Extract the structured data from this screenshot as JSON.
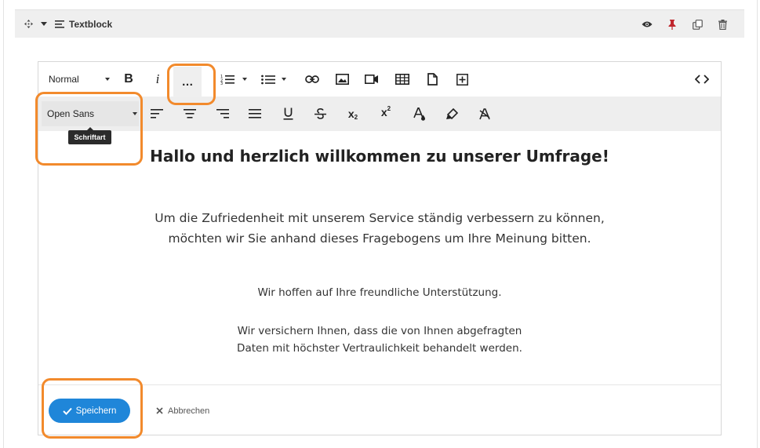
{
  "header": {
    "title": "Textblock",
    "icons": [
      "move-icon",
      "collapse-caret-icon",
      "textblock-lines-icon",
      "eye-icon",
      "pin-icon",
      "copy-icon",
      "trash-icon"
    ]
  },
  "toolbar": {
    "format_select": "Normal",
    "bold": "B",
    "italic": "i",
    "more": "…",
    "font_select": "Open Sans",
    "subscript": "x",
    "subscript_small": "2",
    "superscript": "x",
    "superscript_small": "2",
    "tooltip": "Schriftart"
  },
  "content": {
    "heading": "Hallo und herzlich willkommen zu unserer Umfrage!",
    "intro_line1": "Um die Zufriedenheit mit unserem Service ständig verbessern zu können,",
    "intro_line2": "möchten wir Sie anhand dieses Fragebogens um Ihre Meinung bitten.",
    "support": "Wir hoffen auf Ihre freundliche Unterstützung.",
    "privacy_line1": "Wir versichern Ihnen, dass die von Ihnen abgefragten",
    "privacy_line2": "Daten mit höchster Vertraulichkeit behandelt werden."
  },
  "footer": {
    "save_label": "Speichern",
    "cancel_label": "Abbrechen"
  },
  "colors": {
    "highlight": "#f28a2c",
    "primary": "#1f86d9",
    "pin": "#c0262d"
  }
}
